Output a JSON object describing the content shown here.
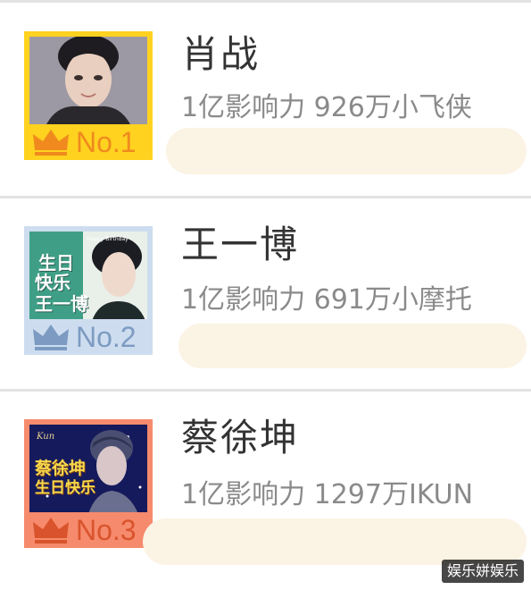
{
  "ranking": [
    {
      "rank_label": "No.1",
      "name": "肖战",
      "stats": "1亿影响力 926万小飞侠",
      "frame_color": "#ffd21f",
      "badge_text_color": "#f08a1e",
      "crown_color": "#f08a1e"
    },
    {
      "rank_label": "No.2",
      "name": "王一博",
      "stats": "1亿影响力 691万小摩托",
      "frame_color": "#cdddef",
      "badge_text_color": "#7d9bc2",
      "crown_color": "#7d9bc2"
    },
    {
      "rank_label": "No.3",
      "name": "蔡徐坤",
      "stats": "1亿影响力 1297万IKUN",
      "frame_color": "#f68a6c",
      "badge_text_color": "#d9542c",
      "crown_color": "#d9542c"
    }
  ],
  "poster2": {
    "line1": "生日",
    "line2": "快乐",
    "line3": "王一博",
    "top_text": "Happy Birthday"
  },
  "poster3": {
    "line1": "蔡徐坤",
    "line2": "生日快乐",
    "top_text": "Kun"
  },
  "watermark": "娱乐姘娱乐"
}
